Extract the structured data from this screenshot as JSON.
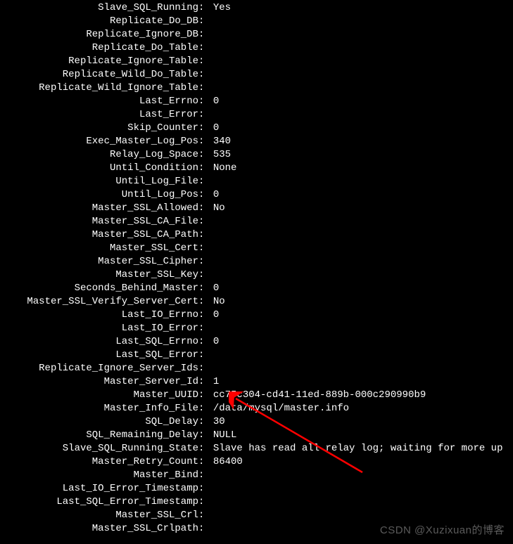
{
  "rows": [
    {
      "label": "Slave_SQL_Running",
      "value": "Yes"
    },
    {
      "label": "Replicate_Do_DB",
      "value": ""
    },
    {
      "label": "Replicate_Ignore_DB",
      "value": ""
    },
    {
      "label": "Replicate_Do_Table",
      "value": ""
    },
    {
      "label": "Replicate_Ignore_Table",
      "value": ""
    },
    {
      "label": "Replicate_Wild_Do_Table",
      "value": ""
    },
    {
      "label": "Replicate_Wild_Ignore_Table",
      "value": ""
    },
    {
      "label": "Last_Errno",
      "value": "0"
    },
    {
      "label": "Last_Error",
      "value": ""
    },
    {
      "label": "Skip_Counter",
      "value": "0"
    },
    {
      "label": "Exec_Master_Log_Pos",
      "value": "340"
    },
    {
      "label": "Relay_Log_Space",
      "value": "535"
    },
    {
      "label": "Until_Condition",
      "value": "None"
    },
    {
      "label": "Until_Log_File",
      "value": ""
    },
    {
      "label": "Until_Log_Pos",
      "value": "0"
    },
    {
      "label": "Master_SSL_Allowed",
      "value": "No"
    },
    {
      "label": "Master_SSL_CA_File",
      "value": ""
    },
    {
      "label": "Master_SSL_CA_Path",
      "value": ""
    },
    {
      "label": "Master_SSL_Cert",
      "value": ""
    },
    {
      "label": "Master_SSL_Cipher",
      "value": ""
    },
    {
      "label": "Master_SSL_Key",
      "value": ""
    },
    {
      "label": "Seconds_Behind_Master",
      "value": "0"
    },
    {
      "label": "Master_SSL_Verify_Server_Cert",
      "value": "No"
    },
    {
      "label": "Last_IO_Errno",
      "value": "0"
    },
    {
      "label": "Last_IO_Error",
      "value": ""
    },
    {
      "label": "Last_SQL_Errno",
      "value": "0"
    },
    {
      "label": "Last_SQL_Error",
      "value": ""
    },
    {
      "label": "Replicate_Ignore_Server_Ids",
      "value": ""
    },
    {
      "label": "Master_Server_Id",
      "value": "1"
    },
    {
      "label": "Master_UUID",
      "value": "cc75c304-cd41-11ed-889b-000c290990b9"
    },
    {
      "label": "Master_Info_File",
      "value": "/data/mysql/master.info"
    },
    {
      "label": "SQL_Delay",
      "value": "30"
    },
    {
      "label": "SQL_Remaining_Delay",
      "value": "NULL"
    },
    {
      "label": "Slave_SQL_Running_State",
      "value": "Slave has read all relay log; waiting for more up"
    },
    {
      "label": "Master_Retry_Count",
      "value": "86400"
    },
    {
      "label": "Master_Bind",
      "value": ""
    },
    {
      "label": "Last_IO_Error_Timestamp",
      "value": ""
    },
    {
      "label": "Last_SQL_Error_Timestamp",
      "value": ""
    },
    {
      "label": "Master_SSL_Crl",
      "value": ""
    },
    {
      "label": "Master_SSL_Crlpath",
      "value": ""
    }
  ],
  "watermark": "CSDN @Xuzixuan的博客"
}
